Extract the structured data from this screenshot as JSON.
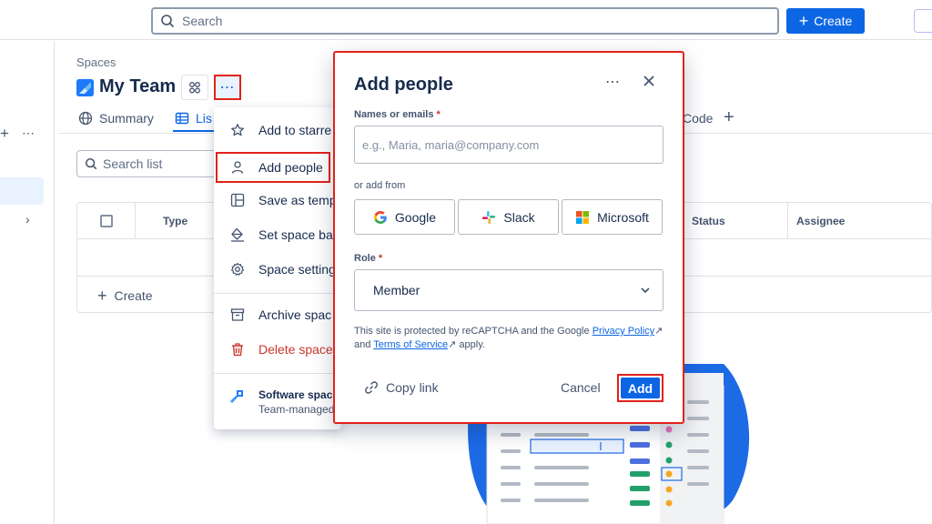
{
  "topbar": {
    "search_placeholder": "Search",
    "create_label": "Create"
  },
  "header": {
    "breadcrumb": "Spaces",
    "title": "My Team",
    "more_label": "⋯"
  },
  "tabs": {
    "summary": "Summary",
    "list": "Lis",
    "code": "Code",
    "add": "+"
  },
  "list": {
    "search_placeholder": "Search list",
    "columns": [
      "Type",
      "Status",
      "Assignee"
    ],
    "create_label": "Create"
  },
  "menu": {
    "items": [
      {
        "label": "Add to starre",
        "icon": "star-icon"
      },
      {
        "label": "Add people",
        "icon": "person-icon"
      },
      {
        "label": "Save as temp",
        "icon": "template-icon"
      },
      {
        "label": "Set space ba",
        "icon": "paint-bucket-icon"
      },
      {
        "label": "Space setting",
        "icon": "gear-icon"
      },
      {
        "label": "Archive spac",
        "icon": "archive-icon"
      },
      {
        "label": "Delete space",
        "icon": "trash-icon"
      }
    ],
    "footer_title": "Software space",
    "footer_subtitle": "Team-managed"
  },
  "modal": {
    "title": "Add people",
    "more_label": "⋯",
    "names_label": "Names or emails",
    "required_mark": "*",
    "names_placeholder": "e.g., Maria, maria@company.com",
    "or_add_from": "or add from",
    "providers": [
      "Google",
      "Slack",
      "Microsoft"
    ],
    "role_label": "Role",
    "role_value": "Member",
    "note_prefix": "This site is protected by reCAPTCHA and the Google",
    "privacy_link": "Privacy Policy",
    "note_and": "and",
    "terms_link": "Terms of Service",
    "note_suffix": "apply.",
    "copy_link": "Copy link",
    "cancel": "Cancel",
    "add": "Add"
  },
  "colors": {
    "primary": "#0c66e4",
    "highlight": "#e2231a",
    "danger": "#c9372c"
  }
}
